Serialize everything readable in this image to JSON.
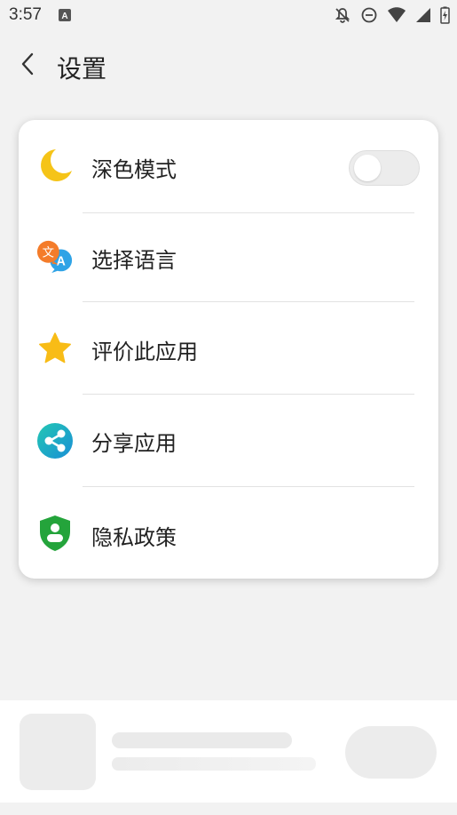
{
  "status_bar": {
    "time": "3:57",
    "icons": [
      "notification-a-icon",
      "notifications-off-icon",
      "do-not-disturb-icon",
      "wifi-icon",
      "signal-icon",
      "battery-charging-icon"
    ]
  },
  "header": {
    "title": "设置",
    "back_icon": "chevron-left-icon"
  },
  "settings": {
    "items": [
      {
        "label": "深色模式",
        "icon": "moon-icon",
        "toggle": {
          "on": false
        }
      },
      {
        "label": "选择语言",
        "icon": "translate-icon"
      },
      {
        "label": "评价此应用",
        "icon": "star-icon"
      },
      {
        "label": "分享应用",
        "icon": "share-icon"
      },
      {
        "label": "隐私政策",
        "icon": "privacy-shield-icon"
      }
    ]
  },
  "colors": {
    "background": "#f2f2f2",
    "card": "#ffffff",
    "moon": "#f5c418",
    "star": "#f8bc16",
    "translate_orange": "#f47c2a",
    "translate_blue": "#2fa3e6",
    "share_teal": "#1eb5c8",
    "shield_green": "#24a43b"
  }
}
